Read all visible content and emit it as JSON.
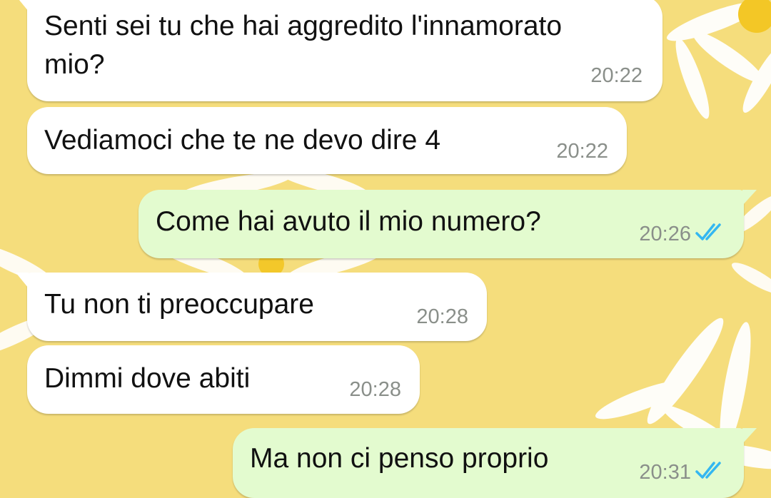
{
  "chat": {
    "messages": [
      {
        "direction": "incoming",
        "text_line1": "Senti sei tu che hai aggredito l'innamorato",
        "text_line2": "mio?",
        "time": "20:22"
      },
      {
        "direction": "incoming",
        "text": "Vediamoci che te ne devo dire 4",
        "time": "20:22"
      },
      {
        "direction": "outgoing",
        "text": "Come hai avuto il mio numero?",
        "time": "20:26",
        "status": "read"
      },
      {
        "direction": "incoming",
        "text": "Tu non ti preoccupare",
        "time": "20:28"
      },
      {
        "direction": "incoming",
        "text": "Dimmi dove abiti",
        "time": "20:28"
      },
      {
        "direction": "outgoing",
        "text": "Ma non ci penso proprio",
        "time": "20:31",
        "status": "read"
      }
    ]
  },
  "colors": {
    "wallpaper": "#f5dd7c",
    "incoming_bubble": "#ffffff",
    "outgoing_bubble": "#e3fbcf",
    "read_ticks": "#34b7f1",
    "timestamp": "#8a8f8a"
  },
  "icons": {
    "read_receipt": "double-check-icon",
    "wallpaper": "daisy-flower-pattern"
  }
}
